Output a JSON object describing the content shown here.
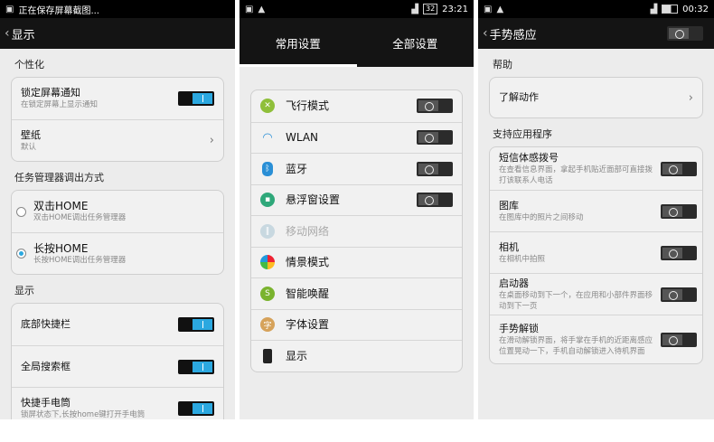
{
  "panel1": {
    "status": "正在保存屏幕截图...",
    "title": "显示",
    "sections": [
      "个性化",
      "任务管理器调出方式",
      "显示"
    ],
    "lock_notify": {
      "title": "锁定屏幕通知",
      "sub": "在锁定屏幕上显示通知"
    },
    "wallpaper": {
      "title": "壁纸",
      "sub": "默认"
    },
    "double_home": {
      "title": "双击HOME",
      "sub": "双击HOME调出任务管理器"
    },
    "long_home": {
      "title": "长按HOME",
      "sub": "长按HOME调出任务管理器"
    },
    "bottom_bar": {
      "title": "底部快捷栏"
    },
    "search_box": {
      "title": "全局搜索框"
    },
    "torch": {
      "title": "快捷手电筒",
      "sub": "锁屏状态下,长按home键打开手电筒"
    }
  },
  "panel2": {
    "status": {
      "battery": "32",
      "time": "23:21"
    },
    "tabs": [
      "常用设置",
      "全部设置"
    ],
    "items": [
      {
        "label": "飞行模式",
        "icon": "airplane-icon",
        "color": "#8fbf3a"
      },
      {
        "label": "WLAN",
        "icon": "wifi-icon",
        "color": "#2a8fd6"
      },
      {
        "label": "蓝牙",
        "icon": "bluetooth-icon",
        "color": "#2a8fd6"
      },
      {
        "label": "悬浮窗设置",
        "icon": "float-window-icon",
        "color": "#2fa87a"
      },
      {
        "label": "移动网络",
        "icon": "mobile-network-icon",
        "color": "#c8d8e0"
      },
      {
        "label": "情景模式",
        "icon": "scene-mode-icon",
        "color": "#e0a020"
      },
      {
        "label": "智能唤醒",
        "icon": "smart-wake-icon",
        "color": "#7ab32e"
      },
      {
        "label": "字体设置",
        "icon": "font-icon",
        "color": "#d6a25a"
      },
      {
        "label": "显示",
        "icon": "display-icon",
        "color": "#222222"
      }
    ]
  },
  "panel3": {
    "status": {
      "time": "00:32"
    },
    "title": "手势感应",
    "sections": [
      "帮助",
      "支持应用程序"
    ],
    "learn": "了解动作",
    "items": [
      {
        "title": "短信体感拨号",
        "sub": "在查看信息界面，拿起手机贴近面部可直接拨打该联系人电话"
      },
      {
        "title": "图库",
        "sub": "在图库中的照片之间移动"
      },
      {
        "title": "相机",
        "sub": "在相机中拍照"
      },
      {
        "title": "启动器",
        "sub": "在桌面移动到下一个，在应用和小部件界面移动到下一页"
      },
      {
        "title": "手势解锁",
        "sub": "在滑动解锁界面，将手掌在手机的近距离感应位置晃动一下，手机自动解锁进入待机界面"
      }
    ]
  }
}
